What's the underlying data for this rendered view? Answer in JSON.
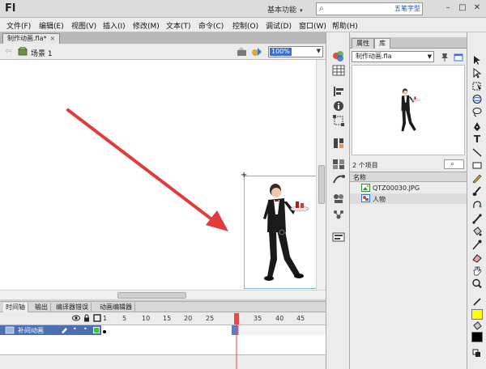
{
  "app": {
    "logo": "Fl",
    "workspace_label": "基本功能",
    "ime_label": "五笔字型"
  },
  "menu": [
    "文件(F)",
    "编辑(E)",
    "视图(V)",
    "插入(I)",
    "修改(M)",
    "文本(T)",
    "命令(C)",
    "控制(O)",
    "调试(D)",
    "窗口(W)",
    "帮助(H)"
  ],
  "document": {
    "tab_label": "制作动画.fla*",
    "scene_label": "场景 1",
    "zoom": "100%"
  },
  "timeline": {
    "tabs": [
      "时间轴",
      "输出",
      "编译器错误",
      "动画编辑器"
    ],
    "frame_numbers": [
      "1",
      "5",
      "10",
      "15",
      "20",
      "25",
      "30",
      "35",
      "40",
      "45"
    ],
    "current_frame": "30",
    "layer_name": "补间动画"
  },
  "library": {
    "tabs": [
      "属性",
      "库"
    ],
    "document_select": "制作动画.fla",
    "item_count": "2 个项目",
    "column_name": "名称",
    "items": [
      {
        "name": "QTZ00030.JPG",
        "icon": "bitmap-icon"
      },
      {
        "name": "人物",
        "icon": "graphic-symbol-icon"
      }
    ]
  },
  "colors": {
    "stroke": "#ffff00",
    "fill": "#000000",
    "layer_highlight": "#4c6fb2",
    "arrow": "#e03c3c"
  }
}
